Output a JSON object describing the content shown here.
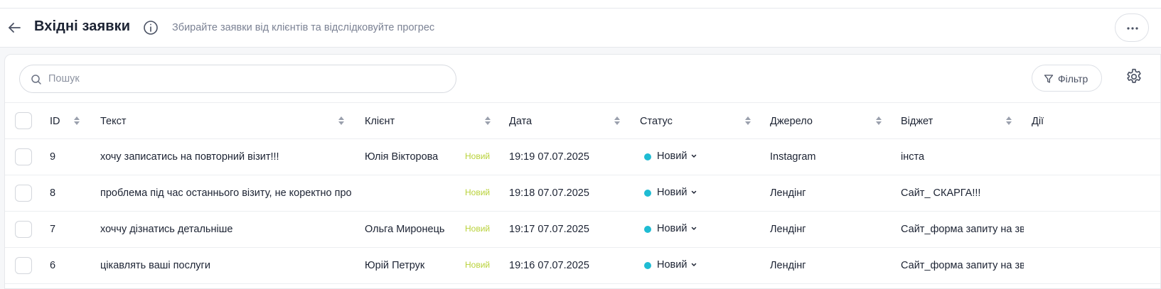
{
  "header": {
    "title": "Вхідні заявки",
    "subtitle": "Збирайте заявки від клієнтів та відслідковуйте прогрес"
  },
  "toolbar": {
    "search_placeholder": "Пошук",
    "search_value": "",
    "filter_label": "Фільтр"
  },
  "table": {
    "columns": [
      "ID",
      "Текст",
      "Клієнт",
      "Дата",
      "Статус",
      "Джерело",
      "Віджет",
      "Дії"
    ],
    "rows": [
      {
        "id": "9",
        "text": "хочу записатись на повторний візит!!!",
        "client": "Юлія Вікторова",
        "badge": "Новий",
        "date": "19:19 07.07.2025",
        "status": "Новий",
        "source": "Instagram",
        "widget": "інста"
      },
      {
        "id": "8",
        "text": "проблема під час останнього візиту, не коректно про",
        "client": "",
        "badge": "Новий",
        "date": "19:18 07.07.2025",
        "status": "Новий",
        "source": "Лендінг",
        "widget": "Сайт_ СКАРГА!!!"
      },
      {
        "id": "7",
        "text": "хоччу дізнатись детальніше",
        "client": "Ольга Миронець",
        "badge": "Новий",
        "date": "19:17 07.07.2025",
        "status": "Новий",
        "source": "Лендінг",
        "widget": "Сайт_форма запиту на зво"
      },
      {
        "id": "6",
        "text": "цікавлять ваші послуги",
        "client": "Юрій Петрук",
        "badge": "Новий",
        "date": "19:16 07.07.2025",
        "status": "Новий",
        "source": "Лендінг",
        "widget": "Сайт_форма запиту на зво"
      }
    ]
  },
  "colors": {
    "status_dot": "#1fbcd3",
    "badge_new": "#b9d23a",
    "text": "#1c2333",
    "muted": "#7b8294"
  },
  "icons": [
    "arrow-left-icon",
    "info-icon",
    "more-horizontal-icon",
    "search-icon",
    "filter-icon",
    "gear-icon",
    "sort-icon",
    "chevron-down-icon"
  ]
}
